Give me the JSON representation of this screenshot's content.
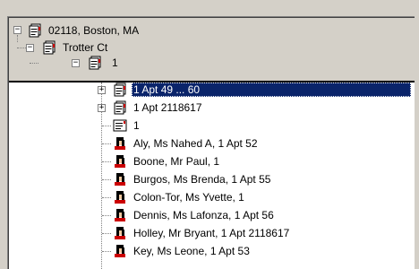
{
  "header": {
    "nodes": [
      {
        "label": "02118, Boston, MA",
        "expander": "−"
      },
      {
        "label": "Trotter Ct",
        "expander": "−"
      },
      {
        "label": "1",
        "expander": "−"
      }
    ]
  },
  "tree": {
    "items": [
      {
        "label": "1 Apt 49 ... 60",
        "expander": "+",
        "icon": "book-icon",
        "selected": true
      },
      {
        "label": "1 Apt 2118617",
        "expander": "+",
        "icon": "book-icon"
      },
      {
        "label": "1",
        "icon": "record-icon"
      },
      {
        "label": "Aly, Ms Nahed A, 1 Apt 52",
        "icon": "person-icon"
      },
      {
        "label": "Boone, Mr Paul, 1",
        "icon": "person-icon"
      },
      {
        "label": "Burgos, Ms Brenda, 1 Apt 55",
        "icon": "person-icon"
      },
      {
        "label": "Colon-Tor, Ms Yvette, 1",
        "icon": "person-icon"
      },
      {
        "label": "Dennis, Ms Lafonza, 1 Apt 56",
        "icon": "person-icon"
      },
      {
        "label": "Holley, Mr Bryant, 1 Apt 2118617",
        "icon": "person-icon"
      },
      {
        "label": "Key, Ms Leone, 1 Apt 53",
        "icon": "person-icon"
      }
    ]
  },
  "colors": {
    "selection": "#0a246a",
    "icon_red": "#cc0000"
  }
}
